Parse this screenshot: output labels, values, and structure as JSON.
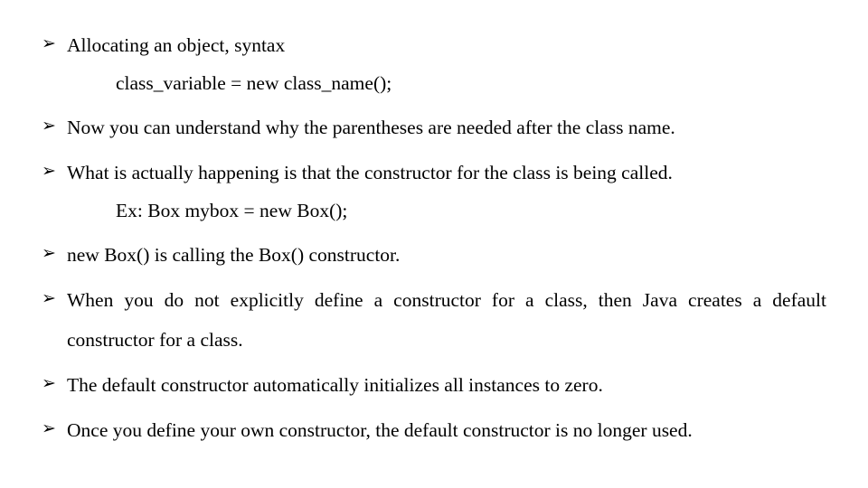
{
  "items": [
    {
      "text": "Allocating an object, syntax",
      "sub": "class_variable = new class_name();"
    },
    {
      "text": "Now you can understand why the parentheses are needed after the class name."
    },
    {
      "text": "What is actually happening is that the constructor for the class is being called.",
      "sub": "Ex: Box mybox = new Box();"
    },
    {
      "text": "new Box() is calling the Box() constructor."
    },
    {
      "text": "When you do not explicitly define a constructor for a class, then Java creates a default constructor for a class."
    },
    {
      "text": "The default constructor automatically initializes all instances to zero."
    },
    {
      "text": "Once you define your own constructor, the default constructor is no longer used."
    }
  ]
}
